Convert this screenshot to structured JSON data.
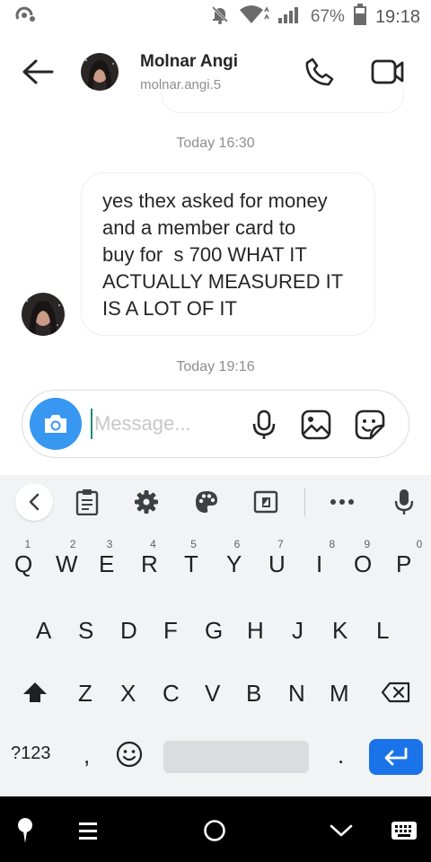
{
  "status_bar": {
    "battery": "67%",
    "time": "19:18",
    "icons": [
      "notification-dot-icon",
      "notifications-off-icon",
      "wifi-icon",
      "signal-icon",
      "battery-icon"
    ]
  },
  "header": {
    "name": "Molnar Angi",
    "username": "molnar.angi.5",
    "icons": [
      "back-arrow-icon",
      "phone-icon",
      "video-camera-icon"
    ]
  },
  "chat": {
    "timestamps": [
      "Today 16:30",
      "Today 19:16"
    ],
    "message": {
      "lines": [
        "yes thex asked for money",
        "and a member card to",
        "buy for  s 700 WHAT IT",
        "ACTUALLY MEASURED IT",
        "IS A LOT OF IT"
      ]
    }
  },
  "composer": {
    "placeholder": "Message...",
    "value": "",
    "icons": [
      "camera-icon",
      "microphone-icon",
      "gallery-icon",
      "sticker-icon"
    ]
  },
  "keyboard": {
    "toolbar_icons": [
      "chevron-left-icon",
      "clipboard-icon",
      "gear-icon",
      "palette-icon",
      "resize-icon",
      "more-icon",
      "microphone-icon"
    ],
    "row1": [
      "Q",
      "W",
      "E",
      "R",
      "T",
      "Y",
      "U",
      "I",
      "O",
      "P"
    ],
    "row1_hints": [
      "1",
      "2",
      "3",
      "4",
      "5",
      "6",
      "7",
      "8",
      "9",
      "0"
    ],
    "row2": [
      "A",
      "S",
      "D",
      "F",
      "G",
      "H",
      "J",
      "K",
      "L"
    ],
    "row3": [
      "Z",
      "X",
      "C",
      "V",
      "B",
      "N",
      "M"
    ],
    "symbols_key": "?123",
    "comma_key": ",",
    "period_key": ".",
    "accent_color": "#1a73e8"
  },
  "nav_bar": {
    "icons": [
      "assistant-icon",
      "menu-icon",
      "home-icon",
      "back-chevron-icon",
      "keyboard-icon"
    ]
  },
  "colors": {
    "camera_button": "#3897f0",
    "secondary_text": "#8e8e8e",
    "bubble_border": "#efefef"
  }
}
